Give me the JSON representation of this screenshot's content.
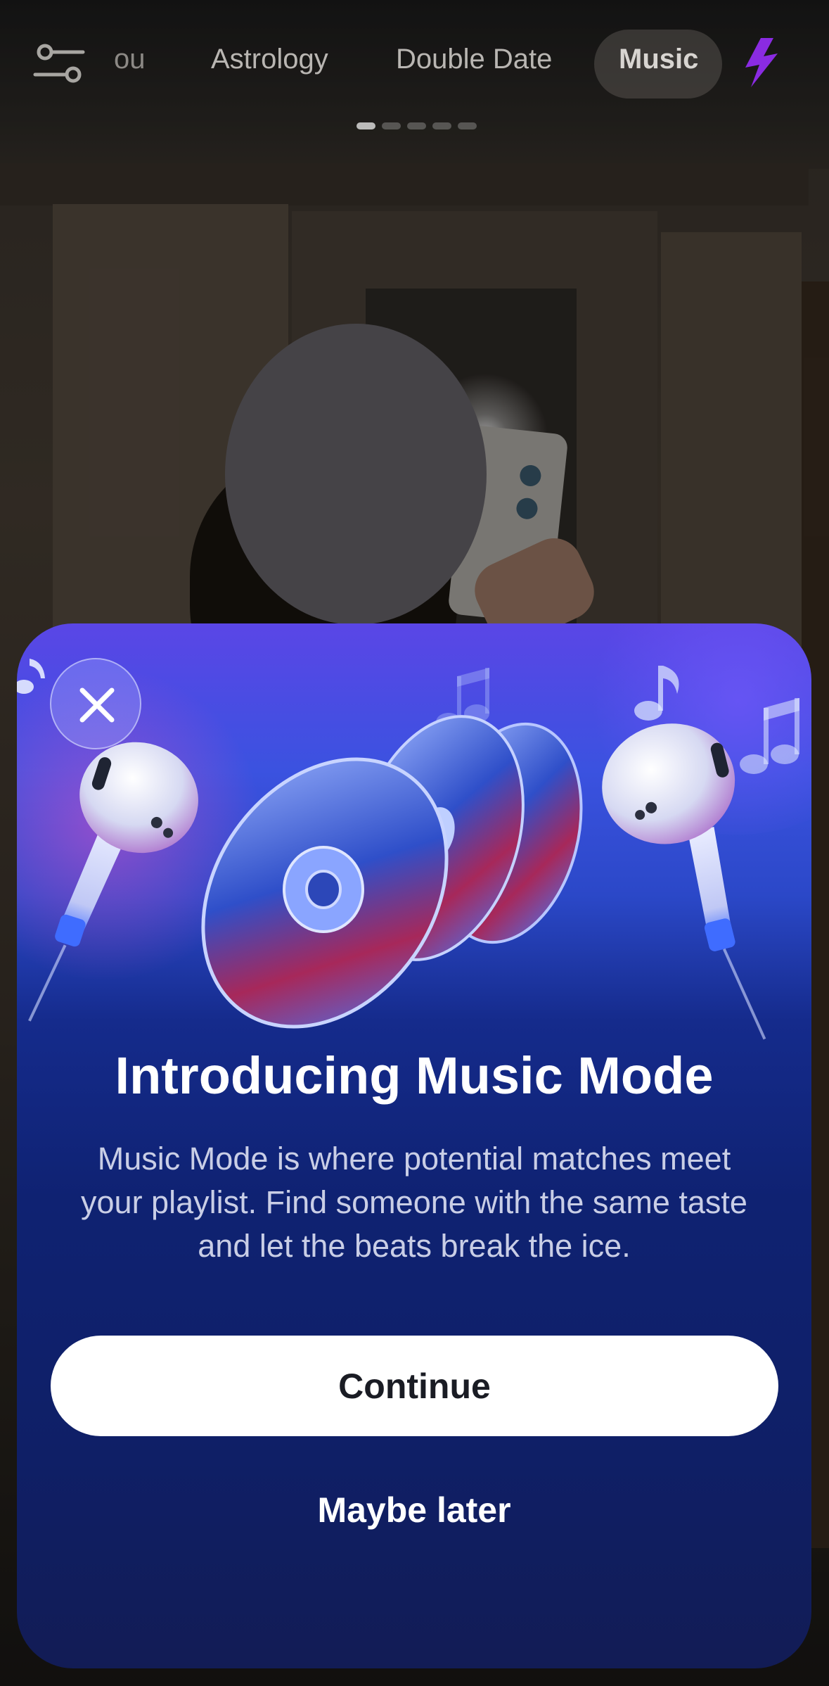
{
  "nav": {
    "tabs": [
      {
        "label": "ou"
      },
      {
        "label": "Astrology"
      },
      {
        "label": "Double Date"
      },
      {
        "label": "Music"
      }
    ],
    "active_tab": "Music",
    "page_count": 5,
    "active_page": 1
  },
  "modal": {
    "title": "Introducing Music Mode",
    "description": "Music Mode is where potential matches meet your playlist. Find someone with the same taste and let the beats break the ice.",
    "primary_button": "Continue",
    "secondary_button": "Maybe later"
  },
  "icons": {
    "filter": "sliders-icon",
    "boost": "lightning-bolt-icon",
    "close": "close-icon"
  },
  "colors": {
    "bolt": "#8a2be2",
    "card_top": "#5a46e6",
    "card_bottom": "#121c55",
    "primary_button_bg": "#ffffff"
  }
}
